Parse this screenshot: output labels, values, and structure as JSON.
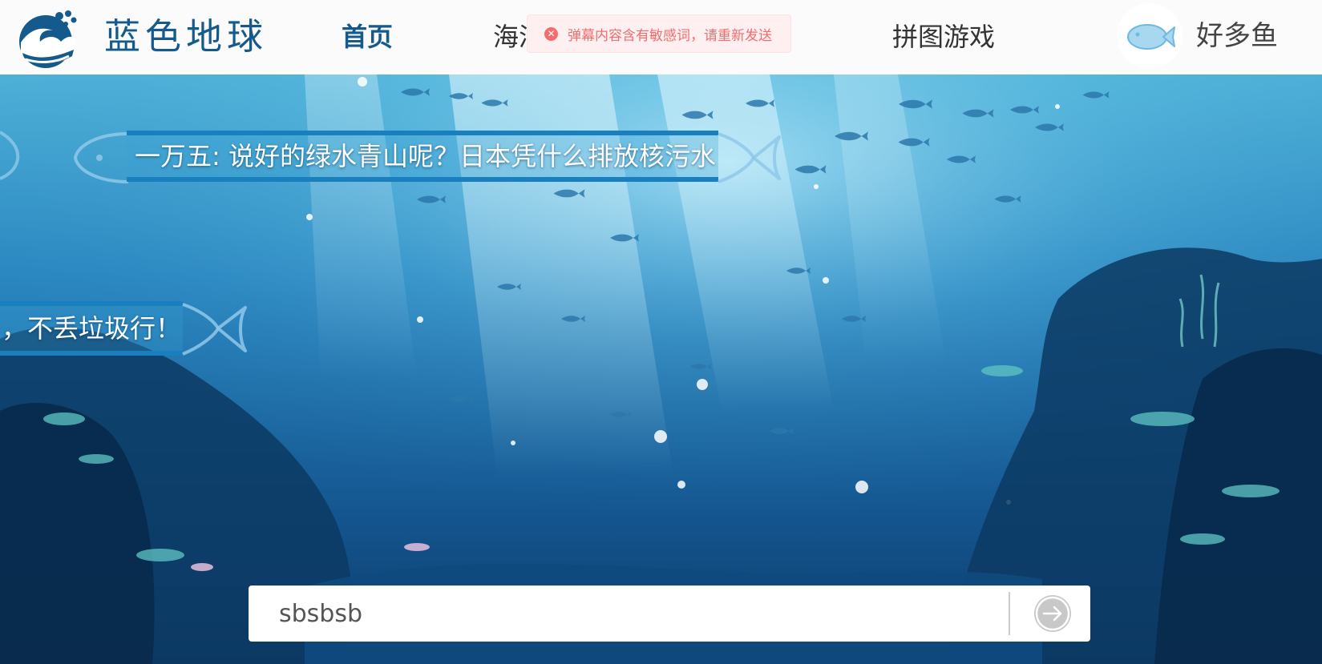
{
  "header": {
    "site_title": "蓝色地球",
    "nav": [
      {
        "label": "首页",
        "active": true
      },
      {
        "label": "海洋",
        "active": false
      },
      {
        "label": "拼图游戏",
        "active": false
      }
    ],
    "user": {
      "name": "好多鱼",
      "avatar_icon": "fish-icon"
    }
  },
  "toast": {
    "type": "error",
    "icon": "close-circle-icon",
    "text": "弹幕内容含有敏感词，请重新发送"
  },
  "danmaku": [
    {
      "text": "一万五: 说好的绿水青山呢？日本凭什么排放核污水"
    },
    {
      "text": "，不丢垃圾行！"
    }
  ],
  "message_input": {
    "value": "sbsbsb",
    "send_icon": "arrow-right-icon"
  },
  "colors": {
    "brand": "#155a8c",
    "error": "#f56c6c",
    "error_bg": "#fef0f0",
    "danmaku_bar": "#1a7fbf"
  }
}
